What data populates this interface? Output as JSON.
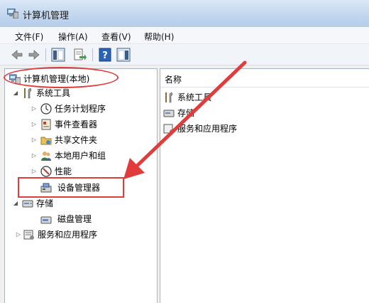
{
  "window": {
    "title": "计算机管理",
    "title_icon": "computer-management-icon"
  },
  "menu": {
    "items": [
      {
        "label": "文件(F)"
      },
      {
        "label": "操作(A)"
      },
      {
        "label": "查看(V)"
      },
      {
        "label": "帮助(H)"
      }
    ]
  },
  "toolbar": {
    "buttons": [
      {
        "icon": "back-arrow-icon"
      },
      {
        "icon": "forward-arrow-icon"
      },
      {
        "icon": "show-hide-console-tree-icon"
      },
      {
        "icon": "export-list-icon"
      },
      {
        "icon": "help-icon"
      },
      {
        "icon": "show-hide-action-pane-icon"
      }
    ]
  },
  "tree": {
    "root": {
      "label": "计算机管理(本地)",
      "icon": "computer-management-icon"
    },
    "system_tools": {
      "label": "系统工具",
      "icon": "tools-icon",
      "children": [
        {
          "label": "任务计划程序",
          "icon": "clock-icon"
        },
        {
          "label": "事件查看器",
          "icon": "event-viewer-icon"
        },
        {
          "label": "共享文件夹",
          "icon": "shared-folder-icon"
        },
        {
          "label": "本地用户和组",
          "icon": "users-icon"
        },
        {
          "label": "性能",
          "icon": "performance-icon"
        },
        {
          "label": "设备管理器",
          "icon": "device-manager-icon"
        }
      ]
    },
    "storage": {
      "label": "存储",
      "icon": "storage-icon",
      "children": [
        {
          "label": "磁盘管理",
          "icon": "disk-management-icon"
        }
      ]
    },
    "services": {
      "label": "服务和应用程序",
      "icon": "services-icon"
    }
  },
  "list": {
    "header": "名称",
    "items": [
      {
        "label": "系统工具",
        "icon": "tools-icon"
      },
      {
        "label": "存储",
        "icon": "storage-icon"
      },
      {
        "label": "服务和应用程序",
        "icon": "services-icon"
      }
    ]
  },
  "colors": {
    "annotation": "#e23b3b"
  }
}
